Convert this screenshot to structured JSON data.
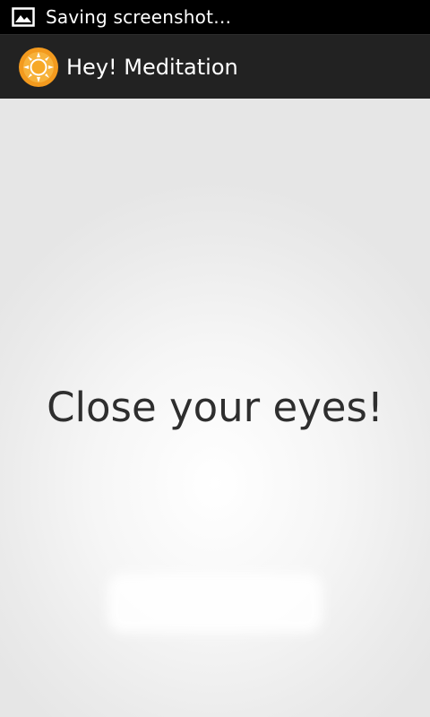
{
  "status_bar": {
    "icon": "image-icon",
    "notification_text": "Saving screenshot…"
  },
  "action_bar": {
    "icon": "sun-icon",
    "title": "Hey! Meditation",
    "background": "#222222"
  },
  "main": {
    "message": "Close your eyes!",
    "text_color": "#2e2e2e"
  }
}
